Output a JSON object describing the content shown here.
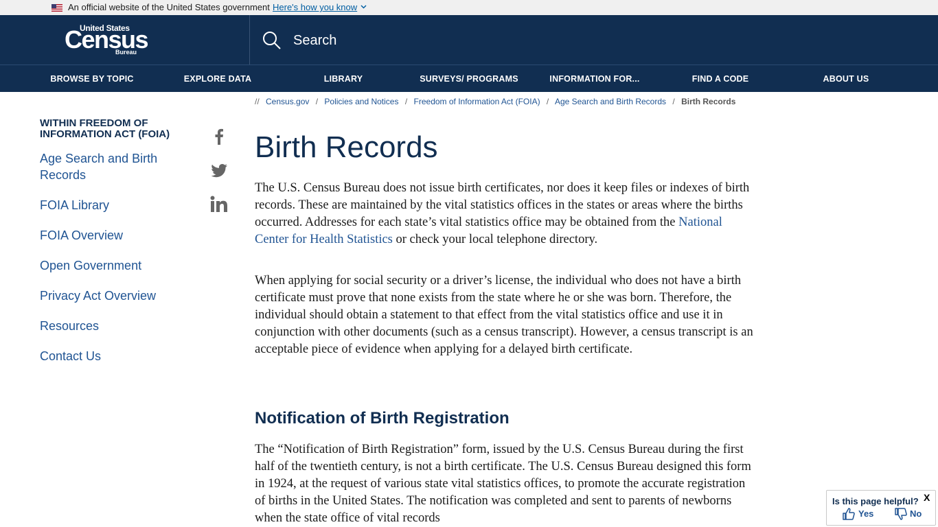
{
  "gov_banner": {
    "official_text": "An official website of the United States government",
    "how_text": "Here's how you know"
  },
  "header": {
    "logo_text_top": "United States",
    "logo_text_main": "Census",
    "logo_text_bottom": "Bureau",
    "search_label": "Search"
  },
  "nav": {
    "items": [
      "BROWSE BY TOPIC",
      "EXPLORE DATA",
      "LIBRARY",
      "SURVEYS/ PROGRAMS",
      "INFORMATION FOR...",
      "FIND A CODE",
      "ABOUT US"
    ]
  },
  "breadcrumb": {
    "items": [
      "Census.gov",
      "Policies and Notices",
      "Freedom of Information Act (FOIA)",
      "Age Search and Birth Records"
    ],
    "current": "Birth Records"
  },
  "sidebar": {
    "heading": "WITHIN FREEDOM OF INFORMATION ACT (FOIA)",
    "items": [
      "Age Search and Birth Records",
      "FOIA Library",
      "FOIA Overview",
      "Open Government",
      "Privacy Act Overview",
      "Resources",
      "Contact Us"
    ]
  },
  "main": {
    "title": "Birth Records",
    "para1_before": "The U.S. Census Bureau does not issue birth certificates, nor does it keep files or indexes of birth records. These are maintained by the vital statistics offices in the states or areas where the births occurred. Addresses for each state’s vital statistics office may be obtained from the ",
    "para1_link": "National Center for Health Statistics",
    "para1_after": " or check your local telephone directory.",
    "para2": "When applying for social security or a driver’s license, the individual who does not have a birth certificate must prove that none exists from the state where he or she was born. Therefore, the individual should obtain a statement to that effect from the vital statistics office and use it in conjunction with other documents (such as a census transcript). However, a census transcript is an acceptable piece of evidence when applying for a delayed birth certificate.",
    "subhead": "Notification of Birth Registration",
    "para3": "The “Notification of Birth Registration” form, issued by the U.S. Census Bureau during the first half of the twentieth century, is not a birth certificate. The U.S. Census Bureau designed this form in 1924, at the request of various state vital statistics offices, to promote the accurate registration of births in the United States. The notification was completed and sent to parents of newborns when the state office of vital records"
  },
  "helpful": {
    "question": "Is this page helpful?",
    "yes": "Yes",
    "no": "No",
    "close": "X"
  },
  "colors": {
    "navy": "#112e51",
    "link": "#205493"
  }
}
